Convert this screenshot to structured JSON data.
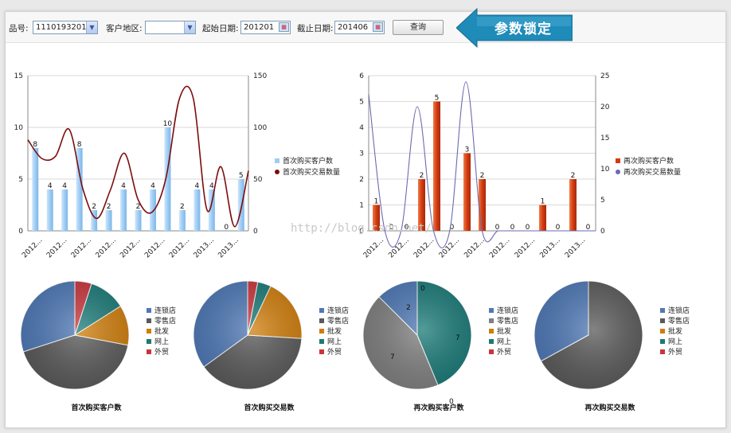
{
  "toolbar": {
    "product_label": "品号:",
    "product_value": "1110193201",
    "region_label": "客户地区:",
    "region_value": "",
    "start_label": "起始日期:",
    "start_value": "201201",
    "end_label": "截止日期:",
    "end_value": "201406",
    "query_button": "查询",
    "lock_text": "参数锁定"
  },
  "watermark": "http://blog.csdn.net/",
  "colors": {
    "bar_blue": "#9fcdf4",
    "line_darkred": "#7b0d0d",
    "bar_orange": "#d23c12",
    "line_purple": "#6b6ab0",
    "lock_blue": "#1e8bb8"
  },
  "chart_data": [
    {
      "type": "bar",
      "categories": [
        "2012...",
        "",
        "2012...",
        "",
        "2012...",
        "",
        "2012...",
        "",
        "2012...",
        "",
        "2012...",
        "",
        "2013...",
        "2013..."
      ],
      "series": [
        {
          "name": "首次购买客户数",
          "type": "bar",
          "axis": "left",
          "values": [
            8,
            4,
            4,
            8,
            2,
            2,
            4,
            2,
            4,
            10,
            2,
            4,
            4,
            0,
            5
          ]
        },
        {
          "name": "首次购买交易数量",
          "type": "line",
          "axis": "right",
          "values": [
            88,
            70,
            72,
            98,
            40,
            12,
            40,
            75,
            30,
            18,
            50,
            128,
            128,
            20,
            62,
            4,
            58
          ]
        }
      ],
      "y_left_ticks": [
        "0",
        "5",
        "10",
        "15"
      ],
      "y_right_ticks": [
        "0",
        "50",
        "100",
        "150"
      ],
      "x_labels": [
        "2012...",
        "2012...",
        "2012...",
        "2012...",
        "2012...",
        "2012...",
        "2012...",
        "2013...",
        "2013..."
      ],
      "ylim_left": [
        0,
        15
      ],
      "ylim_right": [
        0,
        150
      ],
      "legend": "right",
      "grid": true
    },
    {
      "type": "bar",
      "series": [
        {
          "name": "再次购买客户数",
          "type": "bar",
          "axis": "left",
          "values": [
            1,
            0,
            0,
            2,
            5,
            0,
            3,
            2,
            0,
            0,
            0,
            1,
            0,
            2,
            0
          ]
        },
        {
          "name": "再次购买交易数量",
          "type": "line",
          "axis": "right",
          "values": [
            22,
            0,
            0,
            20,
            0,
            0,
            24,
            0,
            0,
            0,
            0,
            0,
            0,
            0,
            0
          ]
        }
      ],
      "y_left_ticks": [
        "0",
        "1",
        "2",
        "3",
        "4",
        "5",
        "6"
      ],
      "y_right_ticks": [
        "0",
        "5",
        "10",
        "15",
        "20",
        "25"
      ],
      "x_labels": [
        "2012...",
        "2012...",
        "2012...",
        "2012...",
        "2012...",
        "2012...",
        "2012...",
        "2013...",
        "2013..."
      ],
      "ylim_left": [
        0,
        6
      ],
      "ylim_right": [
        0,
        25
      ],
      "legend": "right",
      "grid": true
    },
    {
      "type": "pie",
      "title": "首次购买客户数",
      "labels": [
        "连锁店",
        "零售店",
        "批发",
        "网上",
        "外贸"
      ],
      "colors": [
        "#4f79b6",
        "#5a5a5a",
        "#cf7d0b",
        "#1a7a78",
        "#c8363c"
      ],
      "values": [
        30,
        42,
        12,
        11,
        5
      ]
    },
    {
      "type": "pie",
      "title": "首次购买交易数",
      "labels": [
        "连锁店",
        "零售店",
        "批发",
        "网上",
        "外贸"
      ],
      "colors": [
        "#4f79b6",
        "#5a5a5a",
        "#cf7d0b",
        "#1a7a78",
        "#c8363c"
      ],
      "values": [
        35,
        39,
        19,
        4,
        3
      ]
    },
    {
      "type": "pie",
      "title": "再次购买客户数",
      "labels": [
        "连锁店",
        "零售店",
        "批发",
        "网上",
        "外贸"
      ],
      "colors": [
        "#4f79b6",
        "#808080",
        "#cf7d0b",
        "#1a7a78",
        "#c8363c"
      ],
      "values": [
        2,
        7,
        0,
        7,
        0
      ],
      "data_labels": [
        "2",
        "7",
        "0",
        "7",
        "0"
      ]
    },
    {
      "type": "pie",
      "title": "再次购买交易数",
      "labels": [
        "连锁店",
        "零售店",
        "批发",
        "网上",
        "外贸"
      ],
      "colors": [
        "#4f79b6",
        "#5a5a5a",
        "#cf7d0b",
        "#1a7a78",
        "#c8363c"
      ],
      "values": [
        33,
        67,
        0,
        0,
        0
      ]
    }
  ]
}
